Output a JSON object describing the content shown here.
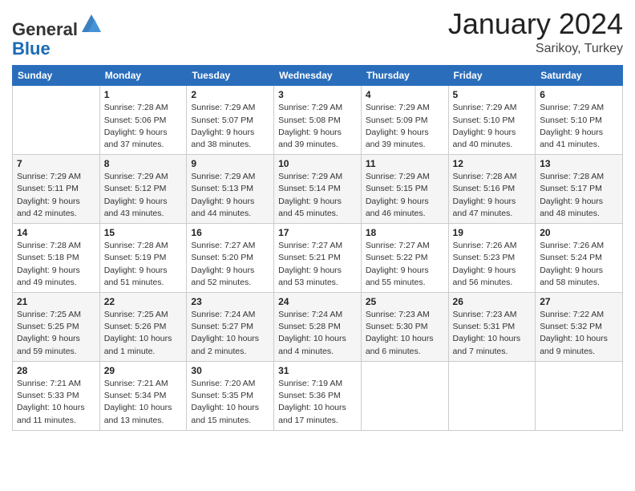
{
  "header": {
    "logo": {
      "line1": "General",
      "line2": "Blue"
    },
    "title": "January 2024",
    "location": "Sarikoy, Turkey"
  },
  "days_of_week": [
    "Sunday",
    "Monday",
    "Tuesday",
    "Wednesday",
    "Thursday",
    "Friday",
    "Saturday"
  ],
  "weeks": [
    [
      {
        "num": "",
        "info": ""
      },
      {
        "num": "1",
        "info": "Sunrise: 7:28 AM\nSunset: 5:06 PM\nDaylight: 9 hours\nand 37 minutes."
      },
      {
        "num": "2",
        "info": "Sunrise: 7:29 AM\nSunset: 5:07 PM\nDaylight: 9 hours\nand 38 minutes."
      },
      {
        "num": "3",
        "info": "Sunrise: 7:29 AM\nSunset: 5:08 PM\nDaylight: 9 hours\nand 39 minutes."
      },
      {
        "num": "4",
        "info": "Sunrise: 7:29 AM\nSunset: 5:09 PM\nDaylight: 9 hours\nand 39 minutes."
      },
      {
        "num": "5",
        "info": "Sunrise: 7:29 AM\nSunset: 5:10 PM\nDaylight: 9 hours\nand 40 minutes."
      },
      {
        "num": "6",
        "info": "Sunrise: 7:29 AM\nSunset: 5:10 PM\nDaylight: 9 hours\nand 41 minutes."
      }
    ],
    [
      {
        "num": "7",
        "info": "Sunrise: 7:29 AM\nSunset: 5:11 PM\nDaylight: 9 hours\nand 42 minutes."
      },
      {
        "num": "8",
        "info": "Sunrise: 7:29 AM\nSunset: 5:12 PM\nDaylight: 9 hours\nand 43 minutes."
      },
      {
        "num": "9",
        "info": "Sunrise: 7:29 AM\nSunset: 5:13 PM\nDaylight: 9 hours\nand 44 minutes."
      },
      {
        "num": "10",
        "info": "Sunrise: 7:29 AM\nSunset: 5:14 PM\nDaylight: 9 hours\nand 45 minutes."
      },
      {
        "num": "11",
        "info": "Sunrise: 7:29 AM\nSunset: 5:15 PM\nDaylight: 9 hours\nand 46 minutes."
      },
      {
        "num": "12",
        "info": "Sunrise: 7:28 AM\nSunset: 5:16 PM\nDaylight: 9 hours\nand 47 minutes."
      },
      {
        "num": "13",
        "info": "Sunrise: 7:28 AM\nSunset: 5:17 PM\nDaylight: 9 hours\nand 48 minutes."
      }
    ],
    [
      {
        "num": "14",
        "info": "Sunrise: 7:28 AM\nSunset: 5:18 PM\nDaylight: 9 hours\nand 49 minutes."
      },
      {
        "num": "15",
        "info": "Sunrise: 7:28 AM\nSunset: 5:19 PM\nDaylight: 9 hours\nand 51 minutes."
      },
      {
        "num": "16",
        "info": "Sunrise: 7:27 AM\nSunset: 5:20 PM\nDaylight: 9 hours\nand 52 minutes."
      },
      {
        "num": "17",
        "info": "Sunrise: 7:27 AM\nSunset: 5:21 PM\nDaylight: 9 hours\nand 53 minutes."
      },
      {
        "num": "18",
        "info": "Sunrise: 7:27 AM\nSunset: 5:22 PM\nDaylight: 9 hours\nand 55 minutes."
      },
      {
        "num": "19",
        "info": "Sunrise: 7:26 AM\nSunset: 5:23 PM\nDaylight: 9 hours\nand 56 minutes."
      },
      {
        "num": "20",
        "info": "Sunrise: 7:26 AM\nSunset: 5:24 PM\nDaylight: 9 hours\nand 58 minutes."
      }
    ],
    [
      {
        "num": "21",
        "info": "Sunrise: 7:25 AM\nSunset: 5:25 PM\nDaylight: 9 hours\nand 59 minutes."
      },
      {
        "num": "22",
        "info": "Sunrise: 7:25 AM\nSunset: 5:26 PM\nDaylight: 10 hours\nand 1 minute."
      },
      {
        "num": "23",
        "info": "Sunrise: 7:24 AM\nSunset: 5:27 PM\nDaylight: 10 hours\nand 2 minutes."
      },
      {
        "num": "24",
        "info": "Sunrise: 7:24 AM\nSunset: 5:28 PM\nDaylight: 10 hours\nand 4 minutes."
      },
      {
        "num": "25",
        "info": "Sunrise: 7:23 AM\nSunset: 5:30 PM\nDaylight: 10 hours\nand 6 minutes."
      },
      {
        "num": "26",
        "info": "Sunrise: 7:23 AM\nSunset: 5:31 PM\nDaylight: 10 hours\nand 7 minutes."
      },
      {
        "num": "27",
        "info": "Sunrise: 7:22 AM\nSunset: 5:32 PM\nDaylight: 10 hours\nand 9 minutes."
      }
    ],
    [
      {
        "num": "28",
        "info": "Sunrise: 7:21 AM\nSunset: 5:33 PM\nDaylight: 10 hours\nand 11 minutes."
      },
      {
        "num": "29",
        "info": "Sunrise: 7:21 AM\nSunset: 5:34 PM\nDaylight: 10 hours\nand 13 minutes."
      },
      {
        "num": "30",
        "info": "Sunrise: 7:20 AM\nSunset: 5:35 PM\nDaylight: 10 hours\nand 15 minutes."
      },
      {
        "num": "31",
        "info": "Sunrise: 7:19 AM\nSunset: 5:36 PM\nDaylight: 10 hours\nand 17 minutes."
      },
      {
        "num": "",
        "info": ""
      },
      {
        "num": "",
        "info": ""
      },
      {
        "num": "",
        "info": ""
      }
    ]
  ]
}
